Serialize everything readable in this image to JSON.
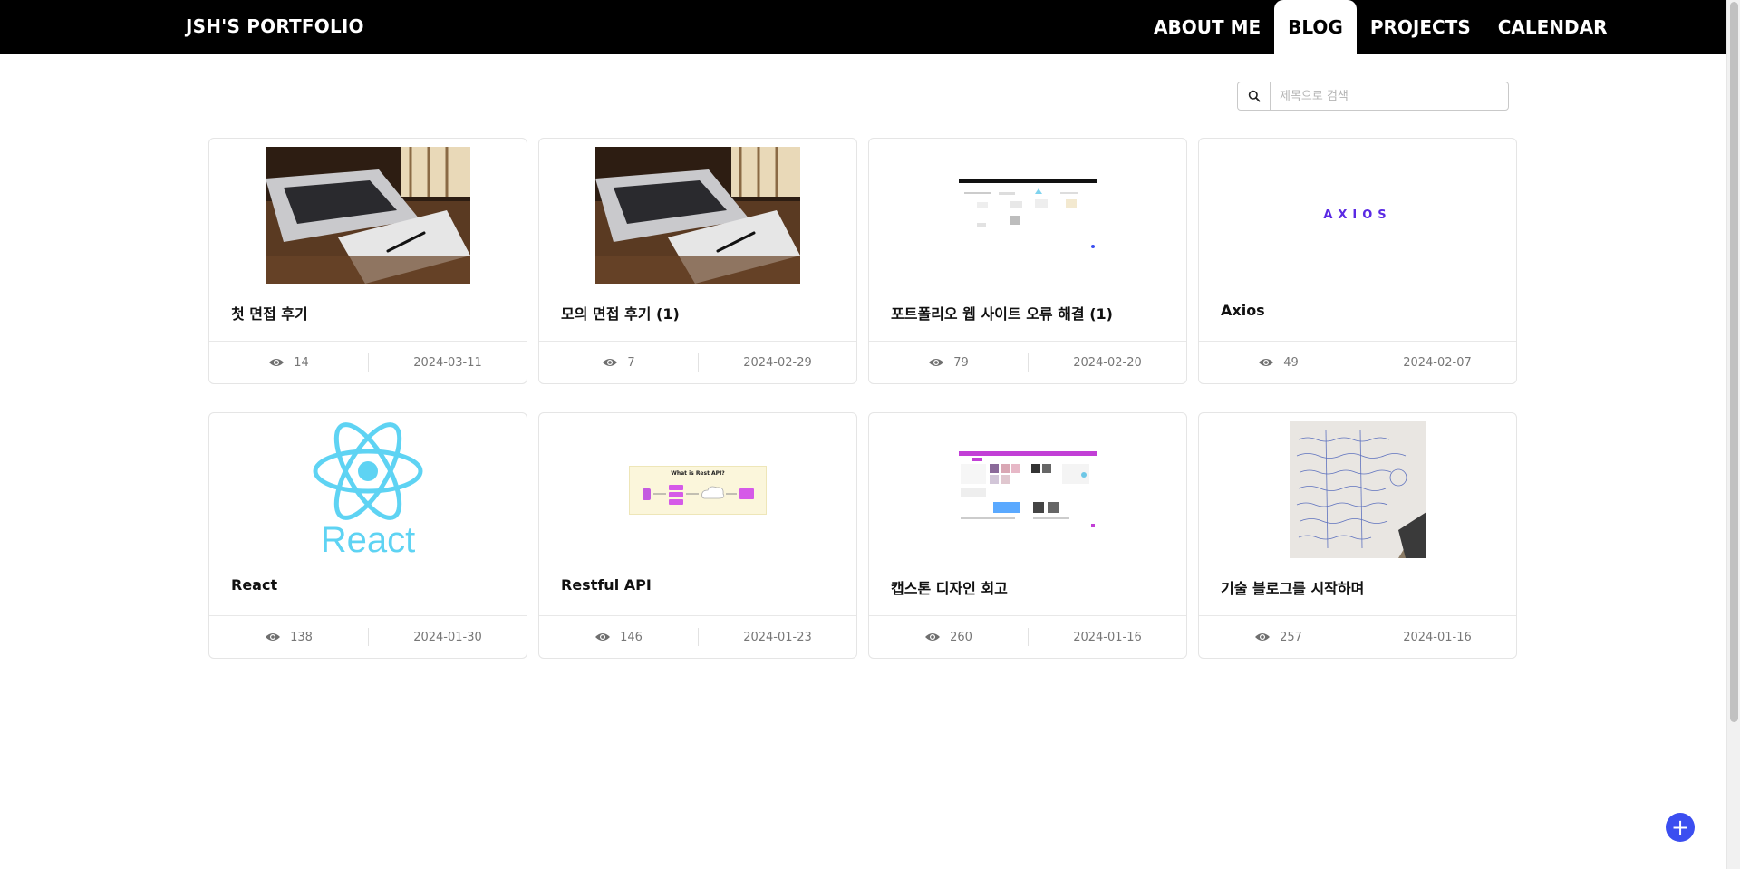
{
  "header": {
    "brand": "JSH'S PORTFOLIO",
    "nav": [
      {
        "label": "ABOUT ME",
        "active": false
      },
      {
        "label": "BLOG",
        "active": true
      },
      {
        "label": "PROJECTS",
        "active": false
      },
      {
        "label": "CALENDAR",
        "active": false
      }
    ]
  },
  "search": {
    "placeholder": "제목으로 검색",
    "value": "",
    "icon": "search-icon"
  },
  "posts": [
    {
      "title": "첫 면접 후기",
      "views": "14",
      "date": "2024-03-11",
      "thumb": "laptop-photo"
    },
    {
      "title": "모의 면접 후기 (1)",
      "views": "7",
      "date": "2024-02-29",
      "thumb": "laptop-photo"
    },
    {
      "title": "포트폴리오 웹 사이트 오류 해결 (1)",
      "views": "79",
      "date": "2024-02-20",
      "thumb": "website-screenshot"
    },
    {
      "title": "Axios",
      "views": "49",
      "date": "2024-02-07",
      "thumb": "axios-logo",
      "logo_text": "AXIOS"
    },
    {
      "title": "React",
      "views": "138",
      "date": "2024-01-30",
      "thumb": "react-logo",
      "logo_text": "React"
    },
    {
      "title": "Restful API",
      "views": "146",
      "date": "2024-01-23",
      "thumb": "rest-api-diagram",
      "diagram_title": "What is Rest API?"
    },
    {
      "title": "캡스톤 디자인 회고",
      "views": "260",
      "date": "2024-01-16",
      "thumb": "design-screenshot"
    },
    {
      "title": "기술 블로그를 시작하며",
      "views": "257",
      "date": "2024-01-16",
      "thumb": "handwritten-notes-photo"
    }
  ],
  "fab": {
    "label": "+",
    "icon": "plus-icon"
  },
  "colors": {
    "header_bg": "#000000",
    "fab": "#3b4ef0",
    "react": "#5ed3f3",
    "axios": "#5a29e4"
  }
}
